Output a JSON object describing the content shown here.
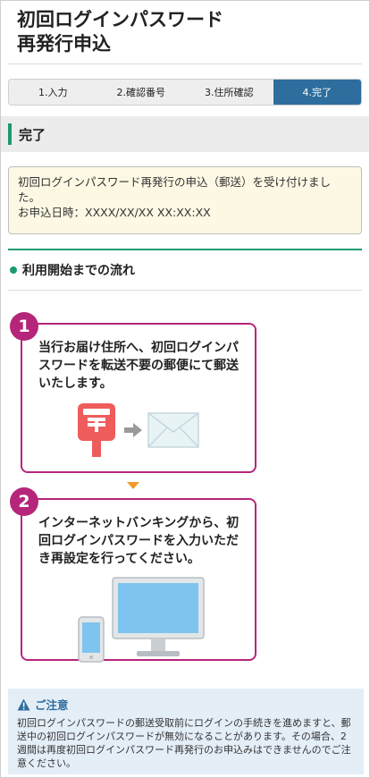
{
  "page": {
    "title_line1": "初回ログインパスワード",
    "title_line2": "再発行申込"
  },
  "steps": [
    {
      "label": "1.入力",
      "active": false
    },
    {
      "label": "2.確認番号",
      "active": false
    },
    {
      "label": "3.住所確認",
      "active": false
    },
    {
      "label": "4.完了",
      "active": true
    }
  ],
  "section": {
    "title": "完了"
  },
  "notice": {
    "line1": "初回ログインパスワード再発行の申込（郵送）を受け付けました。",
    "line2": "お申込日時：XXXX/XX/XX XX:XX:XX"
  },
  "flow": {
    "title": "利用開始までの流れ",
    "steps": [
      {
        "number": "1",
        "text": "当行お届け住所へ、初回ログインパスワードを転送不要の郵便にて郵送いたします。"
      },
      {
        "number": "2",
        "text": "インターネットバンキングから、初回ログインパスワードを入力いただき再設定を行ってください。"
      }
    ]
  },
  "caution": {
    "title": "ご注意",
    "text": "初回ログインパスワードの郵送受取前にログインの手続きを進めますと、郵送中の初回ログインパスワードが無効になることがあります。その場合、2週間は再度初回ログインパスワード再発行のお申込みはできませんのでご注意ください。"
  },
  "icons": [
    "mailbox-icon",
    "arrow-right-icon",
    "envelope-icon",
    "smartphone-icon",
    "desktop-monitor-icon",
    "warning-icon"
  ],
  "colors": {
    "accent_green": "#1d9a6c",
    "step_active": "#2e6e9e",
    "flow_magenta": "#b5267a",
    "notice_bg": "#fdf8e4",
    "caution_bg": "#e4eef7"
  }
}
